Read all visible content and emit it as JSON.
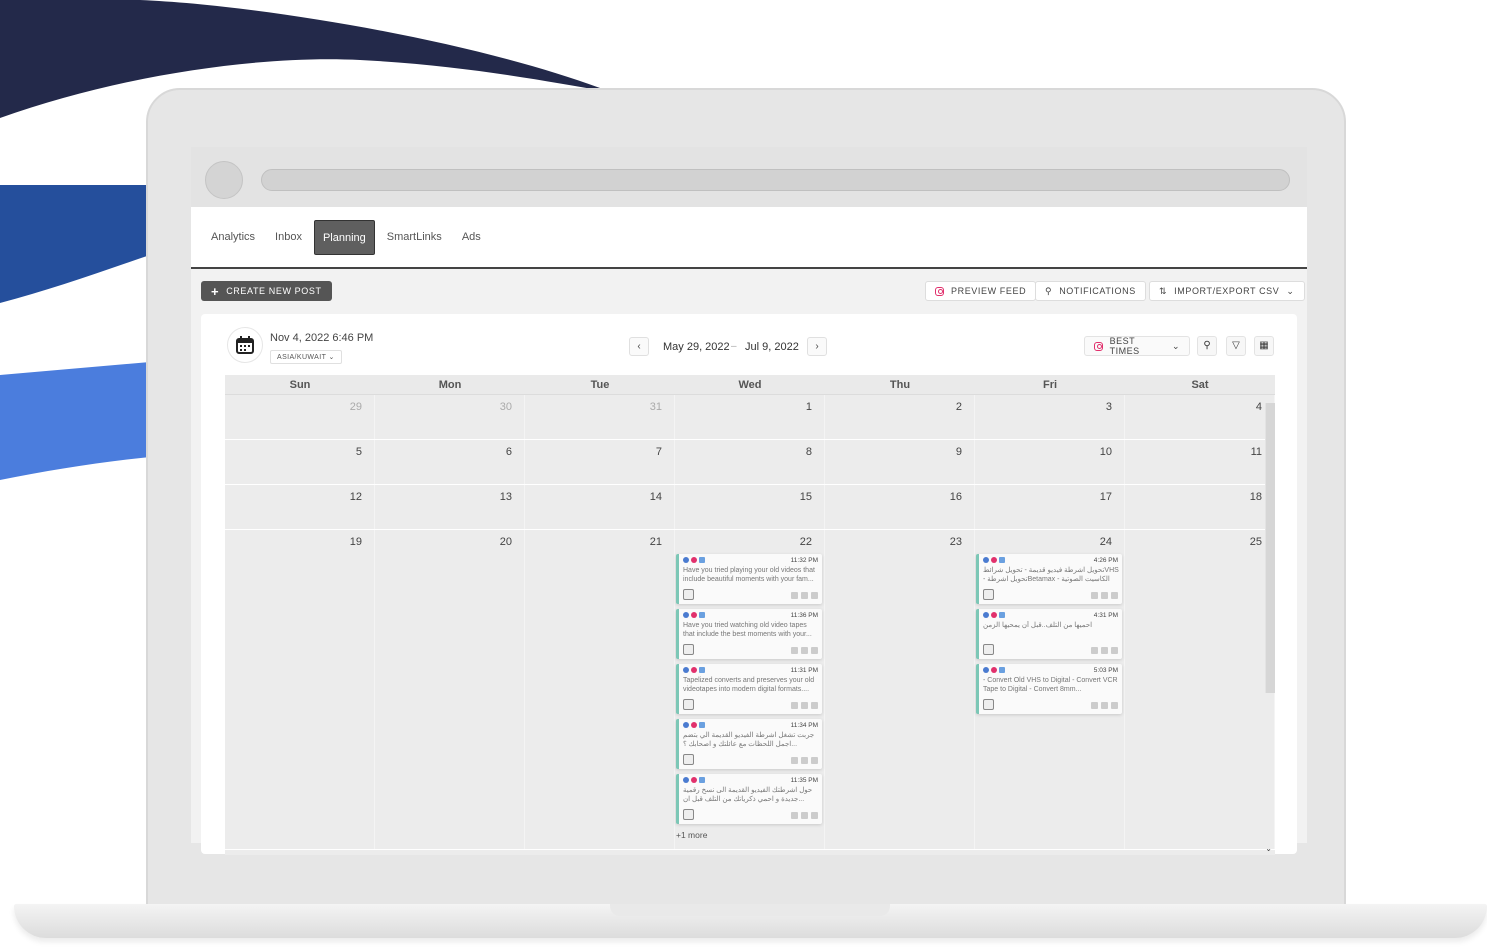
{
  "nav": {
    "tabs": [
      {
        "label": "Analytics"
      },
      {
        "label": "Inbox"
      },
      {
        "label": "Planning",
        "active": true
      },
      {
        "label": "SmartLinks"
      },
      {
        "label": "Ads"
      }
    ]
  },
  "toolbar": {
    "create_label": "CREATE NEW POST",
    "preview_label": "PREVIEW FEED",
    "notifications_label": "NOTIFICATIONS",
    "import_label": "IMPORT/EXPORT CSV"
  },
  "header": {
    "datetime": "Nov 4, 2022 6:46 PM",
    "timezone": "ASIA/KUWAIT",
    "range_start": "May 29, 2022",
    "range_sep": "–",
    "range_end": "Jul 9, 2022",
    "best_times_label": "BEST TIMES"
  },
  "calendar": {
    "weekdays": [
      "Sun",
      "Mon",
      "Tue",
      "Wed",
      "Thu",
      "Fri",
      "Sat"
    ],
    "weeks": [
      [
        {
          "d": "29",
          "m": true
        },
        {
          "d": "30",
          "m": true
        },
        {
          "d": "31",
          "m": true
        },
        {
          "d": "1"
        },
        {
          "d": "2"
        },
        {
          "d": "3"
        },
        {
          "d": "4"
        }
      ],
      [
        {
          "d": "5"
        },
        {
          "d": "6"
        },
        {
          "d": "7"
        },
        {
          "d": "8"
        },
        {
          "d": "9"
        },
        {
          "d": "10"
        },
        {
          "d": "11"
        }
      ],
      [
        {
          "d": "12"
        },
        {
          "d": "13"
        },
        {
          "d": "14"
        },
        {
          "d": "15"
        },
        {
          "d": "16"
        },
        {
          "d": "17"
        },
        {
          "d": "18"
        }
      ],
      [
        {
          "d": "19"
        },
        {
          "d": "20"
        },
        {
          "d": "21"
        },
        {
          "d": "22"
        },
        {
          "d": "23"
        },
        {
          "d": "24"
        },
        {
          "d": "25"
        }
      ]
    ],
    "posts_wed": [
      {
        "time": "11:32 PM",
        "text": "Have you tried playing your old videos that include beautiful moments with your fam..."
      },
      {
        "time": "11:36 PM",
        "text": "Have you tried watching old video tapes that include the best moments with your..."
      },
      {
        "time": "11:31 PM",
        "text": "Tapelized converts and preserves your old videotapes into modern digital formats...."
      },
      {
        "time": "11:34 PM",
        "text": "جربت تشغل اشرطة الفيديو القديمة الي بتضم اجمل اللحظات مع عائلتك و اصحابك ؟..."
      },
      {
        "time": "11:35 PM",
        "text": "حول اشرطتك الفيديو القديمة الى نسخ رقمية جديدة و احمي ذكرياتك من التلف قبل ان..."
      }
    ],
    "posts_fri": [
      {
        "time": "4:26 PM",
        "text": "تحويل اشرطة فيديو قديمة - تحويل شرائطVHS - تحويل اشرطةBetamax - الكاسيت الصوتية"
      },
      {
        "time": "4:31 PM",
        "text": "احميها من التلف..قبل أن يمحيها الزمن"
      },
      {
        "time": "5:03 PM",
        "text": "- Convert Old VHS to Digital - Convert VCR Tape to Digital - Convert 8mm..."
      }
    ],
    "more_label": "+1 more"
  },
  "colors": {
    "accent": "#5f5f5f",
    "post_border": "#7cc7b6",
    "facebook": "#4a7bd0",
    "instagram": "#e1306c",
    "wave_dark": "#23294a",
    "wave_mid": "#254f9c",
    "wave_light": "#4b7ddd"
  }
}
